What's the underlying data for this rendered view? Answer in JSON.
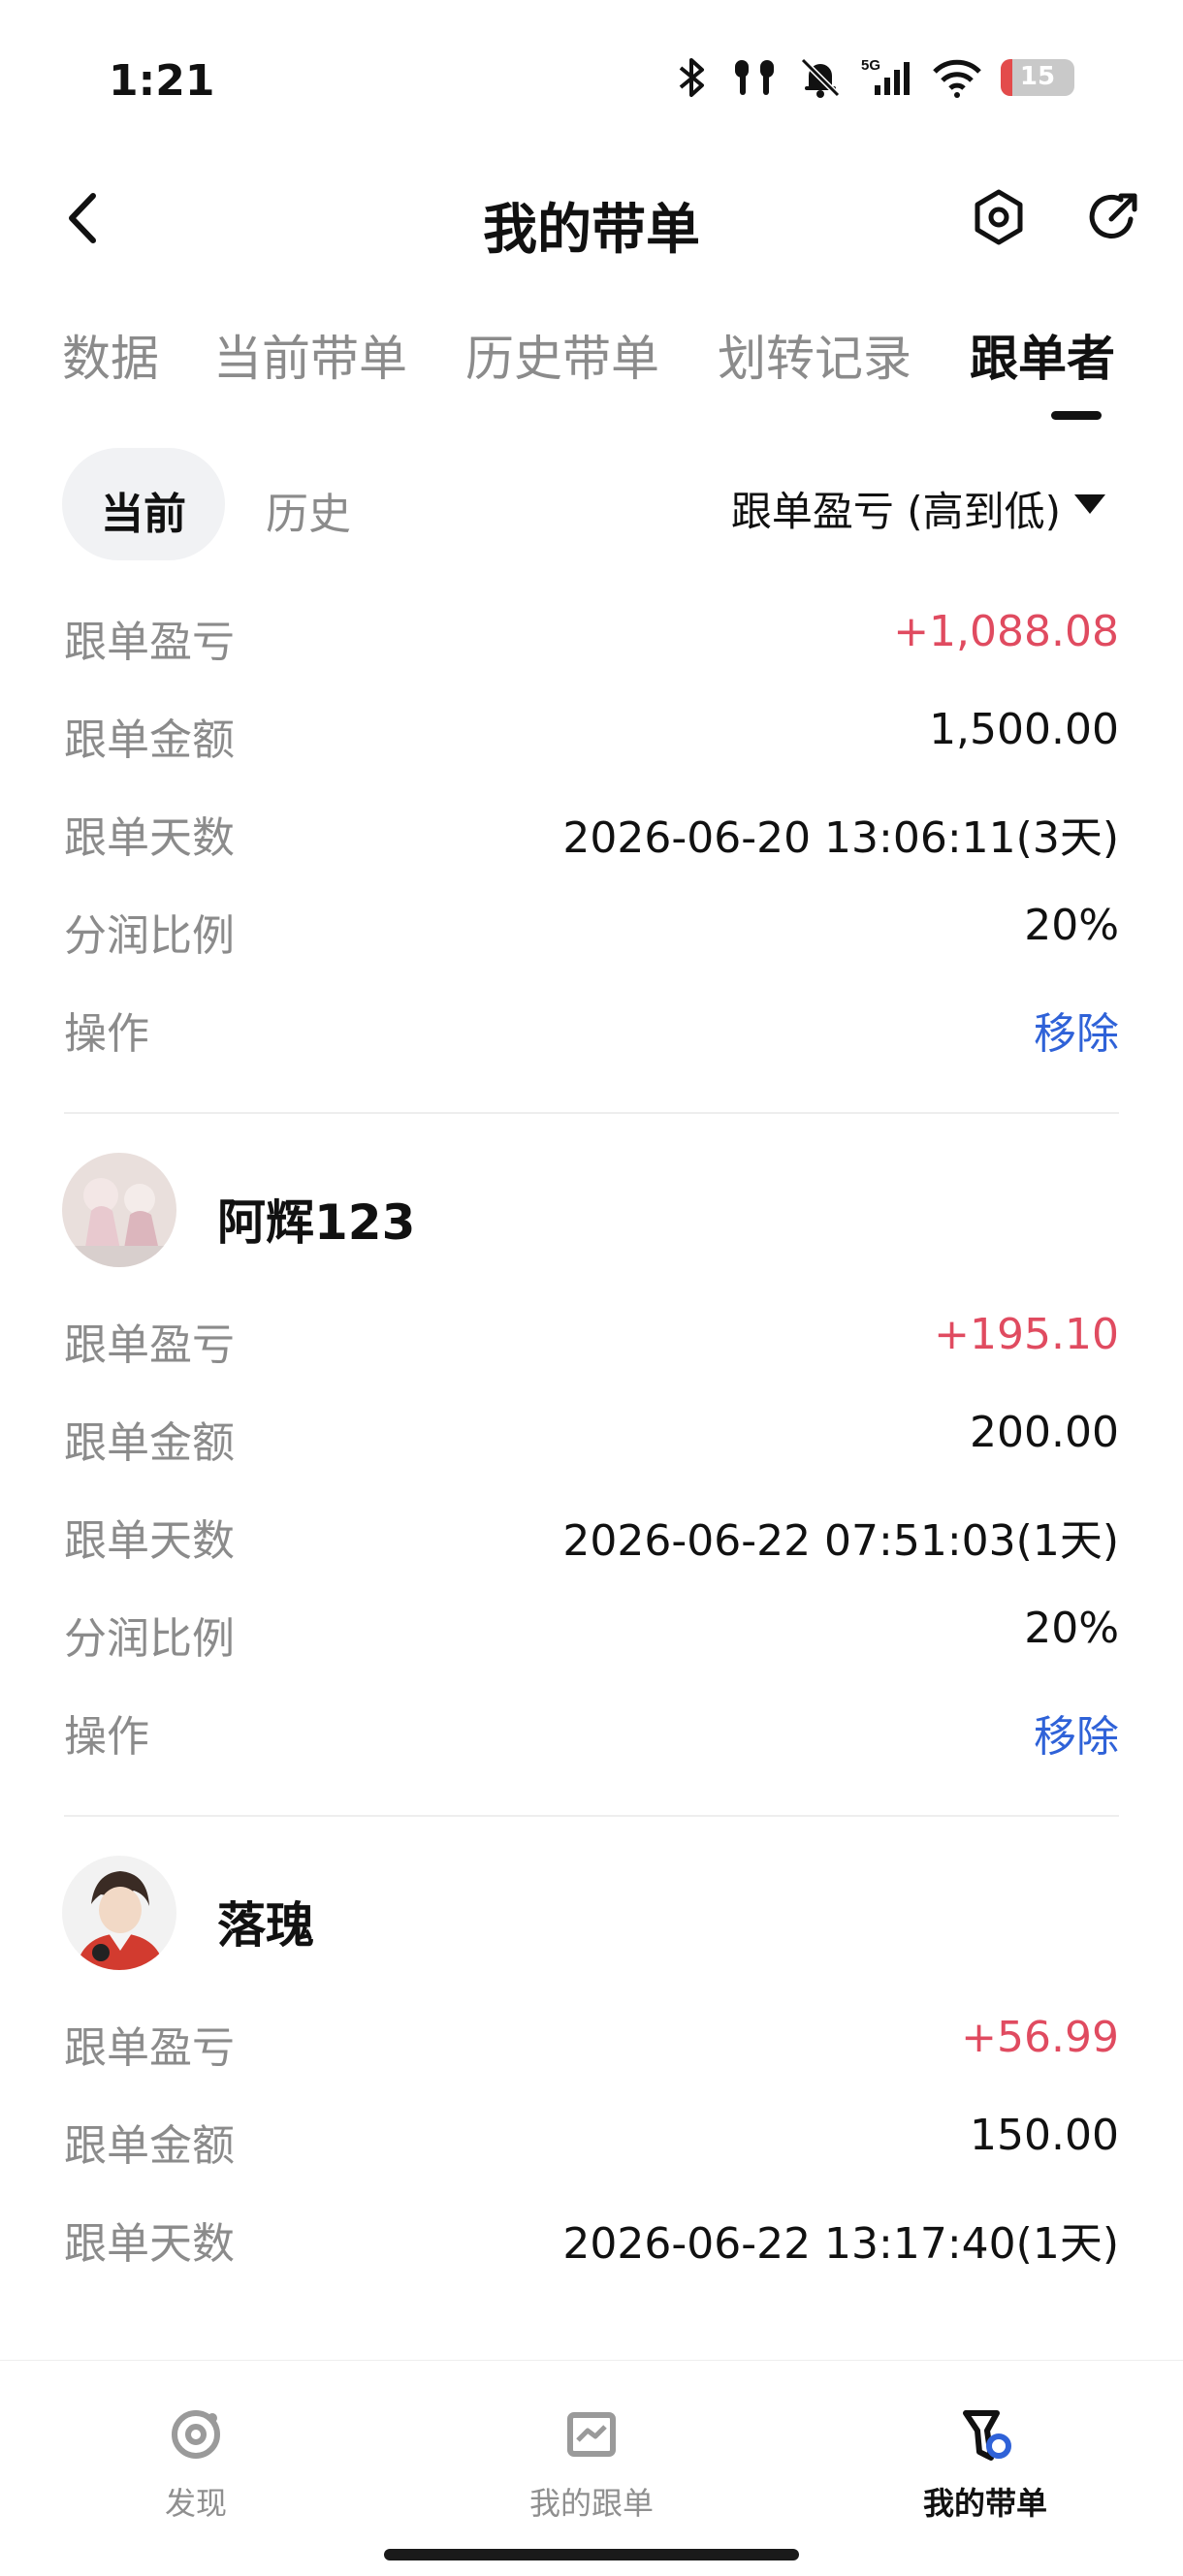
{
  "status_bar": {
    "time": "1:21",
    "network": "5G",
    "battery": "15",
    "battery_color": "#e34b4b"
  },
  "header": {
    "title": "我的带单",
    "back_icon": "back-chevron-icon",
    "settings_icon": "hexagon-settings-icon",
    "share_icon": "share-arrow-icon"
  },
  "tabs": [
    {
      "label": "数据"
    },
    {
      "label": "当前带单"
    },
    {
      "label": "历史带单"
    },
    {
      "label": "划转记录"
    },
    {
      "label": "跟单者",
      "active": true
    }
  ],
  "subtabs": {
    "current": "当前",
    "history": "历史",
    "sort": "跟单盈亏 (高到低)"
  },
  "followers": [
    {
      "name": "",
      "rows": [
        {
          "label": "跟单盈亏",
          "value": "+1,088.08"
        },
        {
          "label": "跟单金额",
          "value": "1,500.00"
        },
        {
          "label": "跟单天数",
          "value": "2026-06-20 13:06:11(3天)"
        },
        {
          "label": "分润比例",
          "value": "20%"
        },
        {
          "label": "操作",
          "value": "移除"
        }
      ]
    },
    {
      "name": "阿辉123",
      "rows": [
        {
          "label": "跟单盈亏",
          "value": "+195.10"
        },
        {
          "label": "跟单金额",
          "value": "200.00"
        },
        {
          "label": "跟单天数",
          "value": "2026-06-22 07:51:03(1天)"
        },
        {
          "label": "分润比例",
          "value": "20%"
        },
        {
          "label": "操作",
          "value": "移除"
        }
      ]
    },
    {
      "name": "落瑰",
      "rows": [
        {
          "label": "跟单盈亏",
          "value": "+56.99"
        },
        {
          "label": "跟单金额",
          "value": "150.00"
        },
        {
          "label": "跟单天数",
          "value": "2026-06-22 13:17:40(1天)"
        }
      ]
    }
  ],
  "bottom_nav": [
    {
      "label": "发现",
      "icon": "discover-icon"
    },
    {
      "label": "我的跟单",
      "icon": "chart-icon"
    },
    {
      "label": "我的带单",
      "icon": "leader-icon",
      "active": true
    }
  ],
  "colors": {
    "profit": "#e04b60",
    "link": "#2f62d8",
    "muted": "#8b8b8b"
  }
}
